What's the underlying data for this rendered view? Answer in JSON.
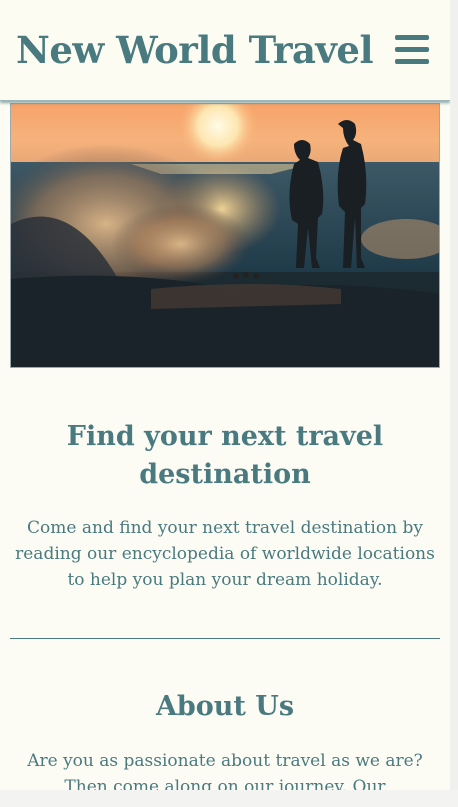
{
  "header": {
    "site_title": "New World Travel",
    "menu_icon": "hamburger-menu-icon"
  },
  "hero": {
    "image_description_icon": "beach-sunset-photo"
  },
  "intro": {
    "heading": "Find your next travel destination",
    "text": "Come and find your next travel destination by reading our encyclopedia of worldwide locations to help you plan your dream holiday."
  },
  "about": {
    "heading": "About Us",
    "text": "Are you as passionate about travel as we are? Then come along on our journey. Our"
  },
  "colors": {
    "accent": "#497a80",
    "background": "#fdfcf4"
  }
}
